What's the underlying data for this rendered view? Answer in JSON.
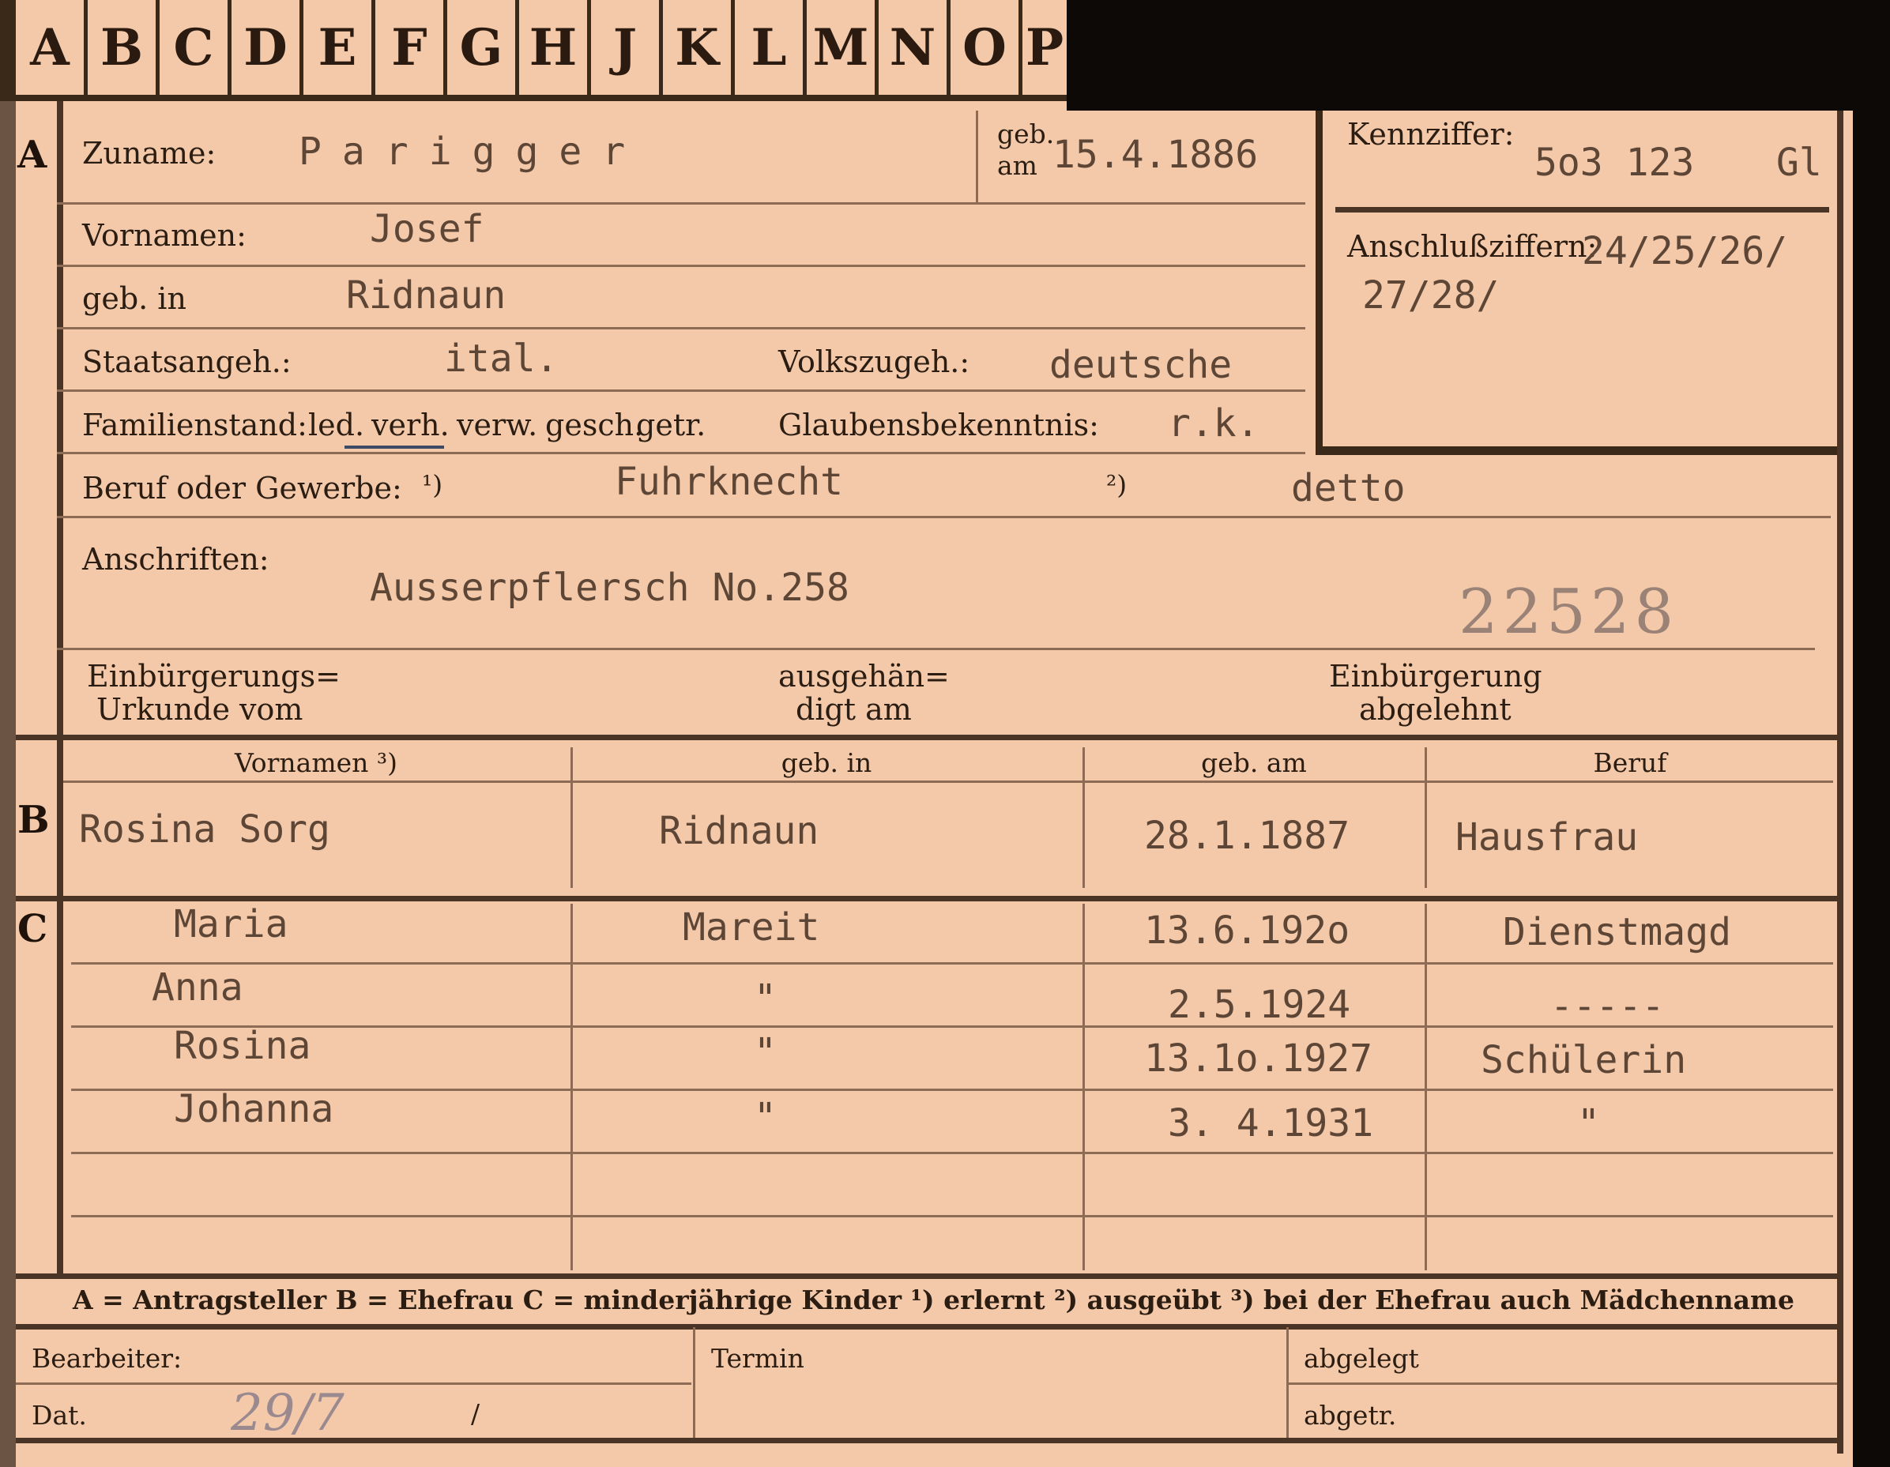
{
  "tabs": [
    "A",
    "B",
    "C",
    "D",
    "E",
    "F",
    "G",
    "H",
    "J",
    "K",
    "L",
    "M",
    "N",
    "O",
    "P"
  ],
  "section_letters": {
    "a": "A",
    "b": "B",
    "c": "C"
  },
  "applicant": {
    "surname_label": "Zuname:",
    "surname": "Parigger",
    "birth_date_label_1": "geb.",
    "birth_date_label_2": "am",
    "birth_date": "15.4.1886",
    "first_names_label": "Vornamen:",
    "first_names": "Josef",
    "birthplace_label": "geb. in",
    "birthplace": "Ridnaun",
    "citizenship_label": "Staatsangeh.:",
    "citizenship": "ital.",
    "ethnicity_label": "Volkszugeh.:",
    "ethnicity": "deutsche",
    "marital_label": "Familienstand:",
    "marital_options": [
      "led.",
      "verh.",
      "verw.",
      "gesch.",
      "getr."
    ],
    "religion_label": "Glaubensbekenntnis:",
    "religion": "r.k.",
    "profession_label": "Beruf oder Gewerbe:",
    "profession_note_1": "¹)",
    "profession_learned": "Fuhrknecht",
    "profession_note_2": "²)",
    "profession_practiced": "detto",
    "address_label": "Anschriften:",
    "address": "Ausserpflersch No.258",
    "stamp_number": "22528",
    "naturalization_doc_label_1": "Einbürgerungs=",
    "naturalization_doc_label_2": "Urkunde vom",
    "handed_label_1": "ausgehän=",
    "handed_label_2": "digt am",
    "refused_label_1": "Einbürgerung",
    "refused_label_2": "abgelehnt"
  },
  "reference": {
    "id_label": "Kennziffer:",
    "id_value": "5o3 123",
    "id_suffix": "Gl",
    "linked_label": "Anschlußziffern:",
    "linked_line_1": "24/25/26/",
    "linked_line_2": "27/28/"
  },
  "spouse_table": {
    "headers": [
      "Vornamen ³)",
      "geb. in",
      "geb. am",
      "Beruf"
    ],
    "row": [
      "Rosina Sorg",
      "Ridnaun",
      "28.1.1887",
      "Hausfrau"
    ]
  },
  "children": [
    [
      "Maria",
      "Mareit",
      "13.6.192o",
      "Dienstmagd"
    ],
    [
      "Anna",
      "\"",
      "2.5.1924",
      "-----"
    ],
    [
      "Rosina",
      "\"",
      "13.1o.1927",
      "Schülerin"
    ],
    [
      "Johanna",
      "\"",
      "3. 4.1931",
      "\""
    ]
  ],
  "legend": "A = Antragsteller   B = Ehefrau   C = minderjährige Kinder   ¹) erlernt   ²) ausgeübt   ³) bei der Ehefrau auch Mädchenname",
  "footer": {
    "clerk_label": "Bearbeiter:",
    "date_label": "Dat.",
    "date_hand": "29/7",
    "date_slash": "/",
    "deadline_label": "Termin",
    "filed_label": "abgelegt",
    "separated_label": "abgetr."
  }
}
